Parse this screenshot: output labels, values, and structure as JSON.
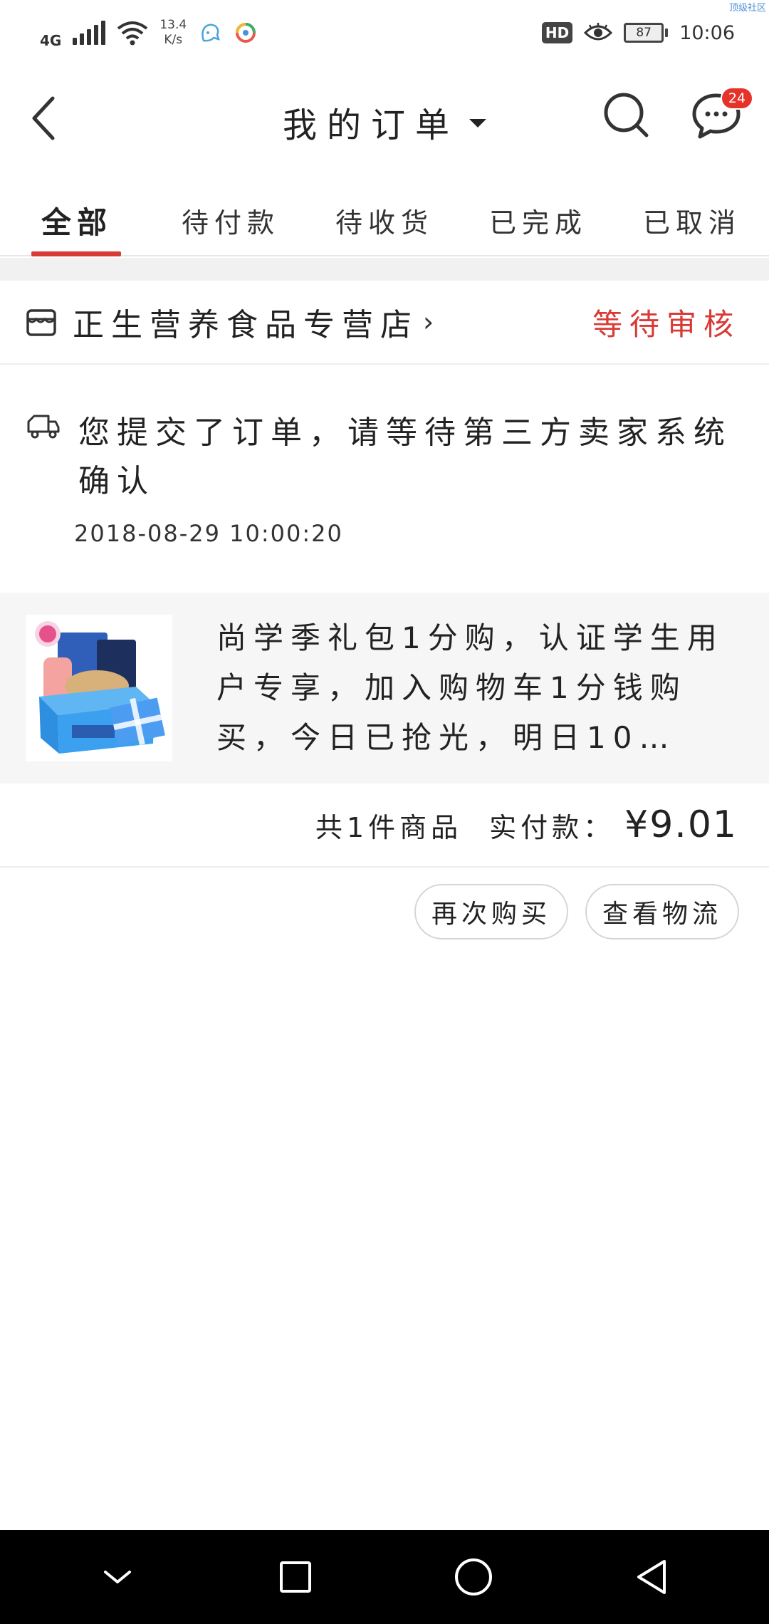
{
  "status_bar": {
    "network": "4G",
    "speed_value": "13.4",
    "speed_unit": "K/s",
    "hd": "HD",
    "battery": "87",
    "time": "10:06",
    "watermark": "顶级社区"
  },
  "header": {
    "title": "我的订单",
    "message_badge": "24"
  },
  "tabs": [
    {
      "label": "全部",
      "active": true
    },
    {
      "label": "待付款",
      "active": false
    },
    {
      "label": "待收货",
      "active": false
    },
    {
      "label": "已完成",
      "active": false
    },
    {
      "label": "已取消",
      "active": false
    }
  ],
  "order": {
    "store_name": "正生营养食品专营店",
    "store_chevron": "›",
    "status": "等待审核",
    "notice": "您提交了订单，请等待第三方卖家系统确认",
    "notice_time": "2018-08-29 10:00:20",
    "product_name": "尚学季礼包1分购，认证学生用户专享，加入购物车1分钱购买，今日已抢光，明日10…",
    "item_count_text": "共1件商品",
    "paid_label": "实付款：",
    "paid_amount": "¥9.01",
    "buttons": {
      "buy_again": "再次购买",
      "view_logistics": "查看物流"
    }
  },
  "colors": {
    "accent": "#d83a36",
    "badge": "#e5332a",
    "nav_bg": "#000000",
    "product_bg": "#f6f6f6"
  }
}
